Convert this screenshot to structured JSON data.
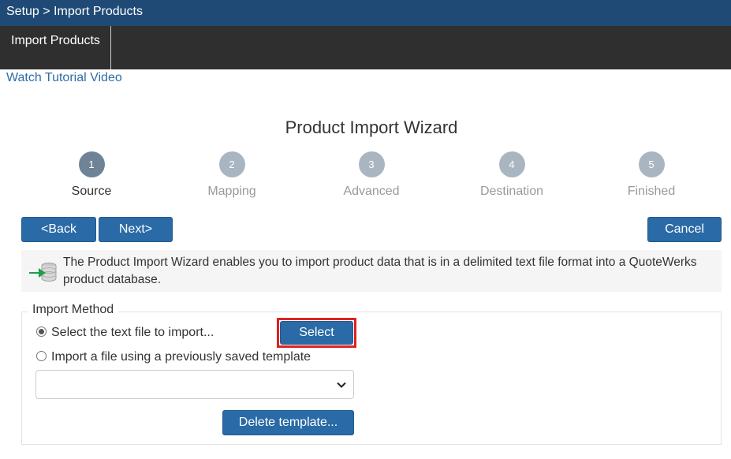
{
  "header": {
    "breadcrumb": "Setup > Import Products"
  },
  "tabs": [
    {
      "label": "Import Products"
    }
  ],
  "links": {
    "tutorial": "Watch Tutorial Video"
  },
  "wizard": {
    "title": "Product Import Wizard",
    "steps": [
      {
        "number": "1",
        "label": "Source",
        "active": true
      },
      {
        "number": "2",
        "label": "Mapping",
        "active": false
      },
      {
        "number": "3",
        "label": "Advanced",
        "active": false
      },
      {
        "number": "4",
        "label": "Destination",
        "active": false
      },
      {
        "number": "5",
        "label": "Finished",
        "active": false
      }
    ]
  },
  "nav_buttons": {
    "back": "<Back",
    "next": "Next>",
    "cancel": "Cancel"
  },
  "info": {
    "icon": "import-arrow-icon",
    "text": "The Product Import Wizard enables you to import product data that is in a delimited text file format into a QuoteWerks product database."
  },
  "import_method": {
    "legend": "Import Method",
    "option_file": "Select the text file to import...",
    "option_template": "Import a file using a previously saved template",
    "selected_option": "file",
    "select_button": "Select",
    "template_value": "",
    "delete_button": "Delete template..."
  },
  "colors": {
    "titlebar": "#1f4a75",
    "tabbar": "#2f2f2f",
    "button": "#2a6aa6",
    "highlight": "#e02020",
    "step_active": "#6e8396",
    "step_inactive": "#a9b6c2"
  }
}
